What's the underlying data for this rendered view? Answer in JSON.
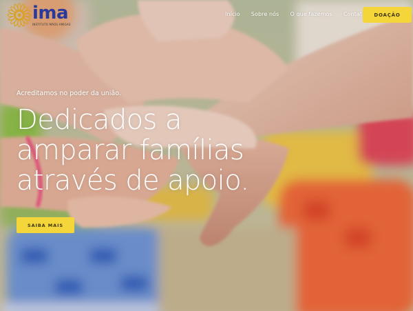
{
  "brand": {
    "name": "ima",
    "subtitle": "INSTITUTO MÃOS AMIGAS",
    "logo_icon": "sun-flower-icon",
    "logo_color": "#d8a21e",
    "name_color": "#2b3a9a"
  },
  "nav": {
    "items": [
      {
        "label": "Início"
      },
      {
        "label": "Sobre nós"
      },
      {
        "label": "O que fazemos"
      },
      {
        "label": "Contato"
      }
    ]
  },
  "header": {
    "donate_label": "DOAÇÃO"
  },
  "hero": {
    "tagline": "Acreditamos no poder da união.",
    "headline": [
      "Dedicados a",
      "amparar famílias",
      "através de apoio."
    ],
    "cta_label": "SAIBA MAIS"
  },
  "colors": {
    "accent_yellow": "#f5d63a",
    "text_on_hero": "#ffffff"
  }
}
